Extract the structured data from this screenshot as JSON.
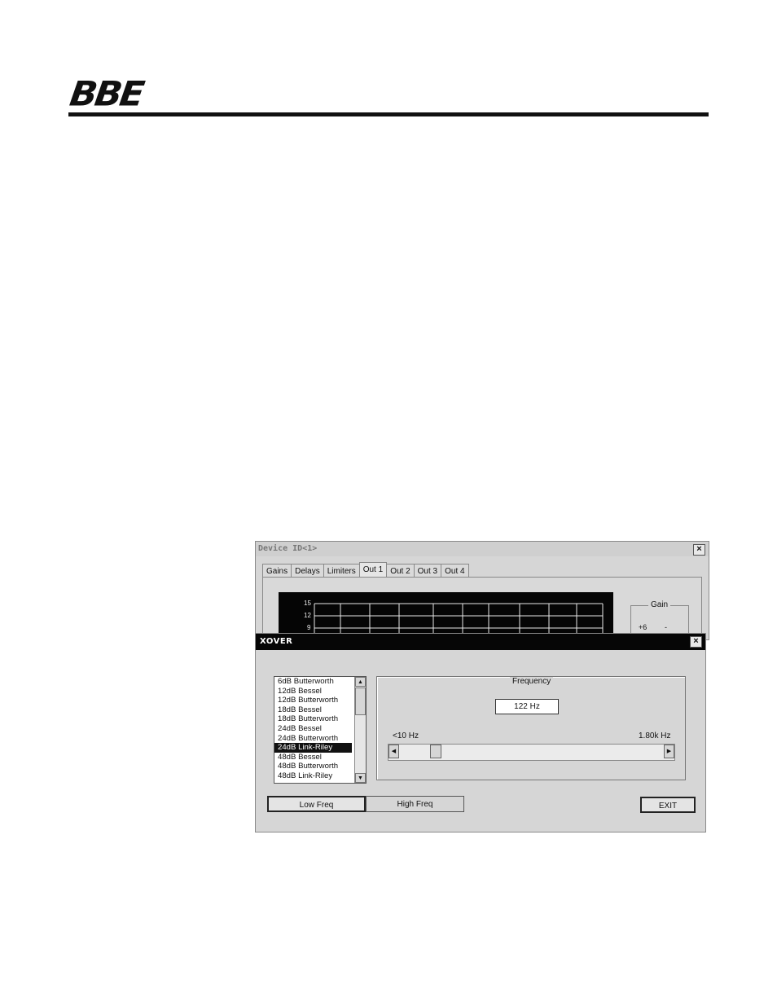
{
  "header": {
    "logo_text": "BBE"
  },
  "device_window": {
    "title": "Device ID<1>",
    "close": "×",
    "tabs": [
      "Gains",
      "Delays",
      "Limiters",
      "Out 1",
      "Out 2",
      "Out 3",
      "Out 4"
    ],
    "active_tab": "Out 1",
    "graph_y_labels": [
      "15",
      "12",
      "9"
    ],
    "gain_group_label": "Gain",
    "gain_value": "+6",
    "gain_minus": "-"
  },
  "xover": {
    "title": "XOVER",
    "close": "×",
    "filter_types": [
      "6dB Butterworth",
      "12dB Bessel",
      "12dB Butterworth",
      "18dB Bessel",
      "18dB Butterworth",
      "24dB Bessel",
      "24dB Butterworth",
      "24dB Link-Riley",
      "48dB Bessel",
      "48dB Butterworth",
      "48dB Link-Riley"
    ],
    "selected_filter": "24dB Link-Riley",
    "frequency_label": "Frequency",
    "frequency_value": "122 Hz",
    "range_min": "<10 Hz",
    "range_max": "1.80k Hz",
    "buttons": {
      "low_freq": "Low Freq",
      "high_freq": "High Freq",
      "exit": "EXIT"
    },
    "active_band": "Low Freq"
  }
}
